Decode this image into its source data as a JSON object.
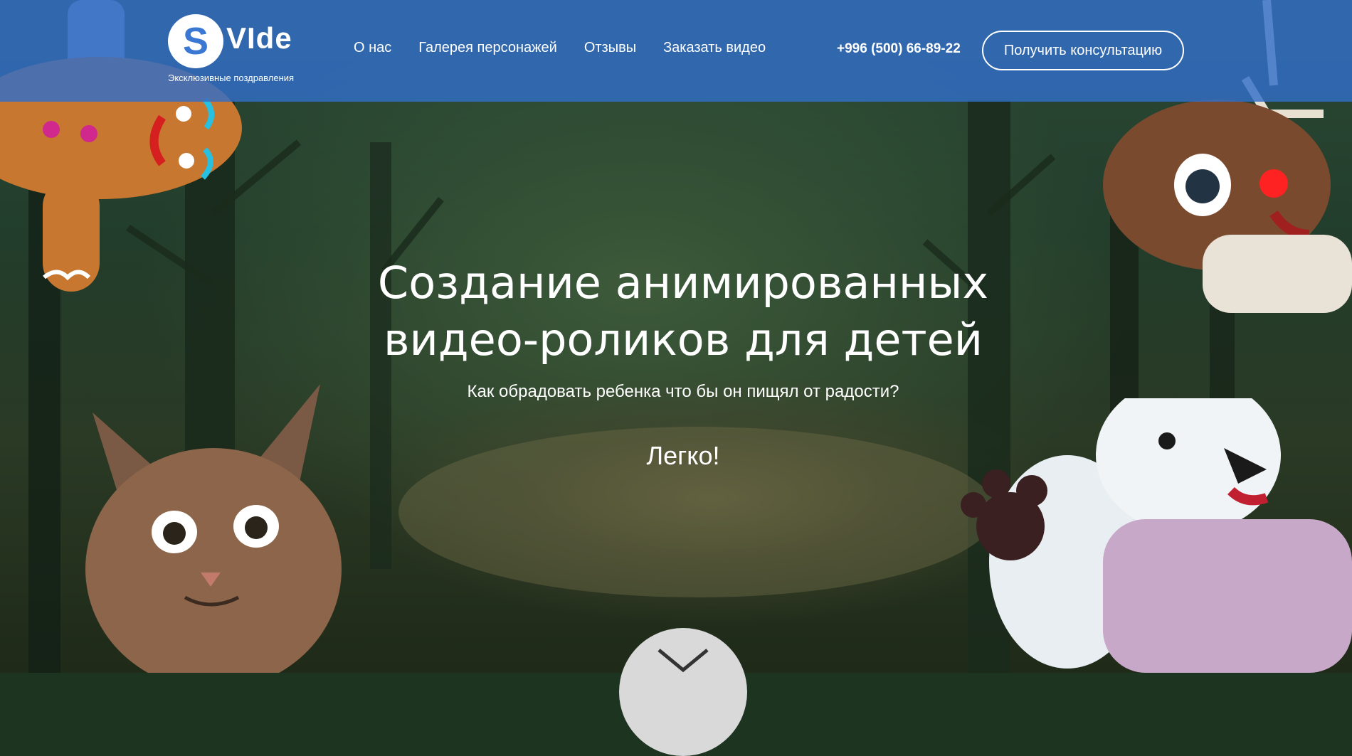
{
  "brand": {
    "logo_letter": "S",
    "name": "VIde",
    "tagline": "Эксклюзивные поздравления"
  },
  "nav": {
    "items": [
      "О нас",
      "Галерея персонажей",
      "Отзывы",
      "Заказать видео"
    ]
  },
  "contact": {
    "phone": "+996 (500) 66-89-22",
    "consult_label": "Получить консультацию"
  },
  "hero": {
    "title_line1": "Создание анимированных",
    "title_line2": "видео-роликов для детей",
    "subtitle": "Как обрадовать ребенка что бы он пищял от радости?",
    "tagline": "Легко!"
  },
  "icons": {
    "scroll": "chevron-down-icon",
    "characters": [
      "gingerbread-man",
      "reindeer",
      "kitten",
      "polar-bear"
    ]
  },
  "colors": {
    "header": "#326ec8",
    "text": "#ffffff",
    "forest": "#2c4a36",
    "scroll_button": "#d9d9d9"
  }
}
